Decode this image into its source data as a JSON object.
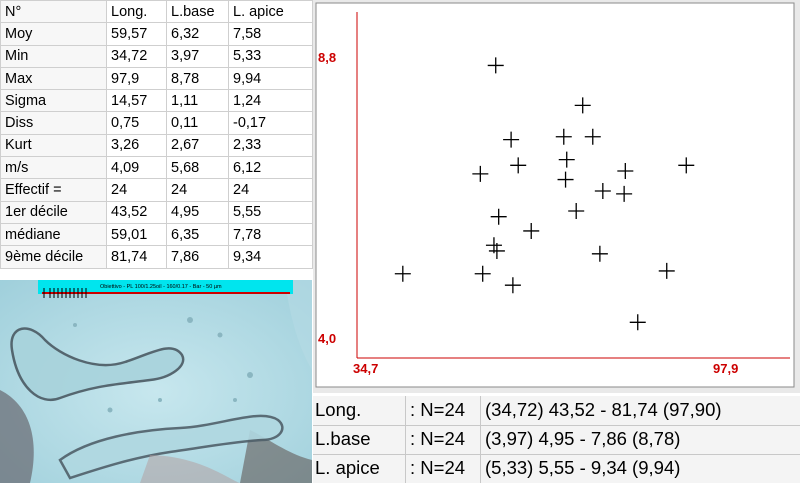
{
  "stats": {
    "headers": [
      "N°",
      "Long.",
      "L.base",
      "L. apice"
    ],
    "rows": [
      [
        "Moy",
        "59,57",
        "6,32",
        "7,58"
      ],
      [
        "Min",
        "34,72",
        "3,97",
        "5,33"
      ],
      [
        "Max",
        "97,9",
        "8,78",
        "9,94"
      ],
      [
        "Sigma",
        "14,57",
        "1,11",
        "1,24"
      ],
      [
        "Diss",
        "0,75",
        "0,11",
        "-0,17"
      ],
      [
        "Kurt",
        "3,26",
        "2,67",
        "2,33"
      ],
      [
        "m/s",
        "4,09",
        "5,68",
        "6,12"
      ],
      [
        "Effectif =",
        "24",
        "24",
        "24"
      ],
      [
        "1er décile",
        "43,52",
        "4,95",
        "5,55"
      ],
      [
        "médiane",
        "59,01",
        "6,35",
        "7,78"
      ],
      [
        "9ème décile",
        "81,74",
        "7,86",
        "9,34"
      ]
    ]
  },
  "scale_bar": {
    "label": "Obiettivo - PL 100/1.25oil - 160/0.17 - Bar - 50 µm",
    "color": "#00e5ee"
  },
  "plot": {
    "x_tick_min": "34,7",
    "x_tick_max": "97,9",
    "y_tick_max": "8,8",
    "y_tick_min": "4,0",
    "axis_color": "#cc0000"
  },
  "chart_data": {
    "type": "scatter",
    "xlim": [
      34.7,
      97.9
    ],
    "ylim": [
      4.0,
      8.8
    ],
    "marker": "plus",
    "x": [
      55.1,
      69.8,
      57.7,
      66.6,
      71.5,
      52.5,
      58.9,
      67.1,
      77.0,
      87.3,
      66.9,
      73.2,
      76.8,
      55.6,
      61.1,
      68.7,
      54.8,
      55.3,
      72.7,
      39.4,
      52.9,
      84.0,
      58.0,
      79.1
    ],
    "y": [
      8.6,
      7.9,
      7.3,
      7.35,
      7.35,
      6.7,
      6.85,
      6.95,
      6.75,
      6.85,
      6.6,
      6.4,
      6.35,
      5.95,
      5.7,
      6.05,
      5.45,
      5.35,
      5.3,
      4.95,
      4.95,
      5.0,
      4.75,
      4.1
    ]
  },
  "summary": [
    {
      "var": "Long.",
      "n": ": N=24",
      "range": "(34,72) 43,52 - 81,74 (97,90)"
    },
    {
      "var": "L.base",
      "n": ": N=24",
      "range": "(3,97) 4,95 - 7,86 (8,78)"
    },
    {
      "var": "L. apice",
      "n": ": N=24",
      "range": "(5,33) 5,55 - 9,34 (9,94)"
    }
  ]
}
